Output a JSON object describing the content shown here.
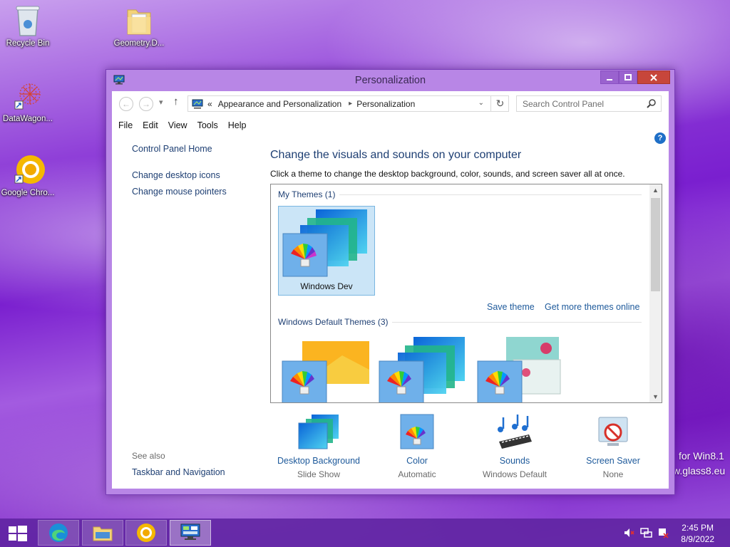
{
  "desktop": {
    "icons": [
      {
        "label": "Recycle Bin"
      },
      {
        "label": "Geometry.D..."
      },
      {
        "label": "DataWagon..."
      },
      {
        "label": "Google Chro..."
      }
    ],
    "overlay": [
      "for Win8.1",
      "w.glass8.eu"
    ]
  },
  "window": {
    "title": "Personalization",
    "address": {
      "prefix": "«",
      "crumbs": [
        "Appearance and Personalization",
        "Personalization"
      ]
    },
    "search_placeholder": "Search Control Panel",
    "menu": [
      "File",
      "Edit",
      "View",
      "Tools",
      "Help"
    ],
    "help_glyph": "?",
    "left_nav": {
      "home": "Control Panel Home",
      "links": [
        "Change desktop icons",
        "Change mouse pointers"
      ],
      "see_also_label": "See also",
      "see_also_link": "Taskbar and Navigation"
    },
    "main": {
      "heading": "Change the visuals and sounds on your computer",
      "subtext": "Click a theme to change the desktop background, color, sounds, and screen saver all at once.",
      "my_themes_label": "My Themes (1)",
      "my_theme_name": "Windows Dev",
      "save_theme": "Save theme",
      "get_more": "Get more themes online",
      "default_themes_label": "Windows Default Themes (3)"
    },
    "cards": [
      {
        "title": "Desktop Background",
        "sub": "Slide Show"
      },
      {
        "title": "Color",
        "sub": "Automatic"
      },
      {
        "title": "Sounds",
        "sub": "Windows Default"
      },
      {
        "title": "Screen Saver",
        "sub": "None"
      }
    ]
  },
  "taskbar": {
    "time": "2:45 PM",
    "date": "8/9/2022"
  },
  "colors": {
    "accent_purple": "#8f3fd8",
    "link_blue": "#1e3f73",
    "close_red": "#c7463b",
    "selection_blue": "#cbe5f7"
  }
}
